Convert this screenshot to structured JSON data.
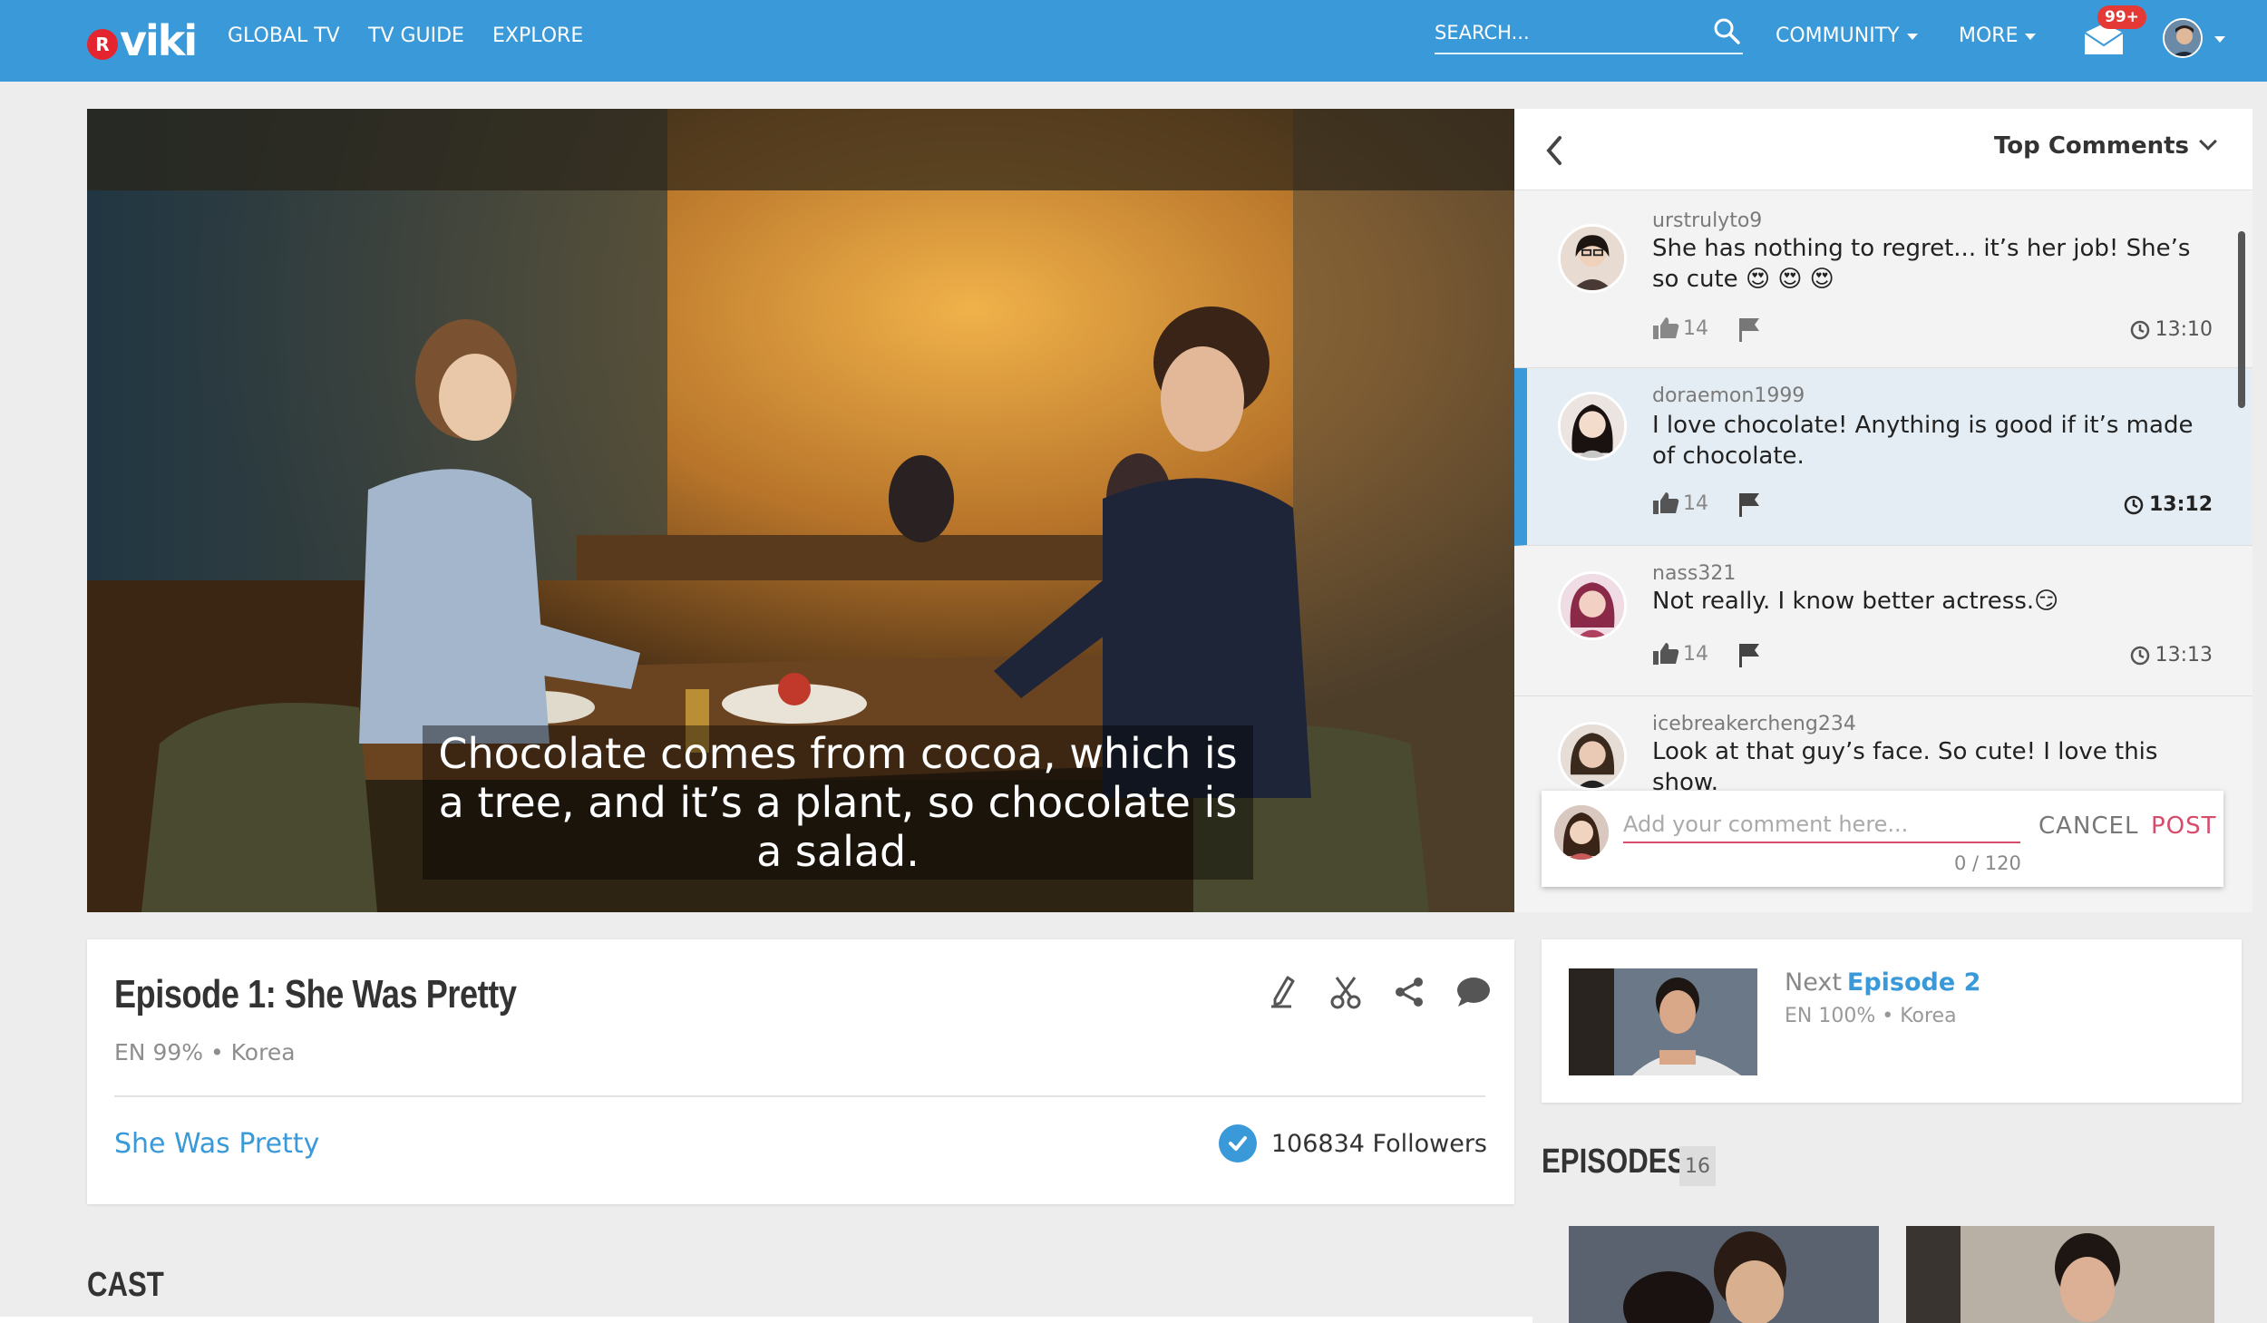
{
  "nav": {
    "logo_badge": "R",
    "logo_text": "viki",
    "links": [
      "GLOBAL TV",
      "TV GUIDE",
      "EXPLORE"
    ],
    "search_placeholder": "SEARCH...",
    "community": "COMMUNITY",
    "more": "MORE",
    "notifications_badge": "99+"
  },
  "video": {
    "subtitle": "Chocolate comes from cocoa, which is a tree, and it’s a plant, so chocolate is a salad."
  },
  "comments": {
    "sort_label": "Top Comments",
    "items": [
      {
        "user": "urstrulyto9",
        "text": "She has nothing to regret... it’s her job! She’s so cute 😍 😍 😍",
        "likes": "14",
        "time": "13:10"
      },
      {
        "user": "doraemon1999",
        "text": "I love chocolate! Anything is good if it’s made of chocolate.",
        "likes": "14",
        "time": "13:12"
      },
      {
        "user": "nass321",
        "text": "Not really. I know better actress.😏",
        "likes": "14",
        "time": "13:13"
      },
      {
        "user": "icebreakercheng234",
        "text": "Look at that guy’s face. So cute! I love this show.",
        "likes": "",
        "time": ""
      }
    ],
    "compose": {
      "placeholder": "Add your comment here...",
      "count": "0 / 120",
      "cancel": "CANCEL",
      "post": "POST"
    }
  },
  "episode": {
    "title": "Episode 1: She Was Pretty",
    "meta": "EN 99% • Korea",
    "show": "She Was Pretty",
    "followers": "106834 Followers"
  },
  "next": {
    "label": "Next",
    "episode": "Episode 2",
    "meta": "EN 100% • Korea"
  },
  "episodes": {
    "title": "EPISODES",
    "count": "16"
  },
  "cast_title": "CAST",
  "colors": {
    "brand": "#3a99d8",
    "accent_red": "#d64c6b",
    "logo_red": "#e4252f"
  }
}
